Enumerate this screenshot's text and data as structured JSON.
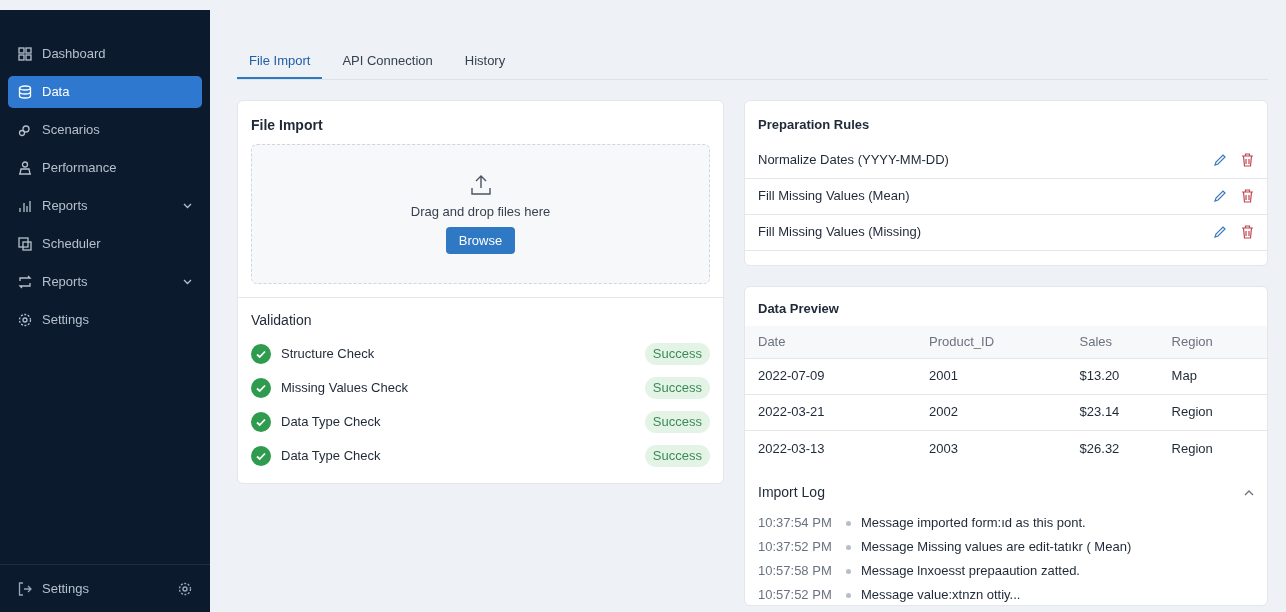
{
  "sidebar": {
    "items": [
      {
        "label": "Dashboard",
        "selected": false
      },
      {
        "label": "Data",
        "selected": true
      },
      {
        "label": "Scenarios",
        "selected": false
      },
      {
        "label": "Performance",
        "selected": false
      },
      {
        "label": "Reports",
        "selected": false,
        "expandable": true
      },
      {
        "label": "Scheduler",
        "selected": false
      },
      {
        "label": "Reports",
        "selected": false,
        "expandable": true
      },
      {
        "label": "Settings",
        "selected": false
      }
    ],
    "footer": {
      "label": "Settings"
    }
  },
  "tabs": [
    {
      "label": "File Import",
      "selected": true
    },
    {
      "label": "API Connection",
      "selected": false
    },
    {
      "label": "History",
      "selected": false
    }
  ],
  "file_import": {
    "title": "File Import",
    "dropzone_text": "Drag and drop files here",
    "button": "Browse"
  },
  "validation": {
    "title": "Validation",
    "items": [
      {
        "label": "Structure Check",
        "status": "Success"
      },
      {
        "label": "Missing Values Check",
        "status": "Success"
      },
      {
        "label": "Data Type Check",
        "status": "Success"
      },
      {
        "label": "Data Type Check",
        "status": "Success"
      }
    ]
  },
  "preparation_rules": {
    "title": "Preparation Rules",
    "rules": [
      "Normalize Dates (YYYY-MM-DD)",
      "Fill Missing Values (Mean)",
      "Fill Missing Values (Missing)"
    ]
  },
  "data_preview": {
    "title": "Data Preview",
    "columns": [
      "Date",
      "Product_ID",
      "Sales",
      "Region"
    ],
    "rows": [
      [
        "2022-07-09",
        "2001",
        "$13.20",
        "Map"
      ],
      [
        "2022-03-21",
        "2002",
        "$23.14",
        "Region"
      ],
      [
        "2022-03-13",
        "2003",
        "$26.32",
        "Region"
      ]
    ]
  },
  "import_log": {
    "title": "Import Log",
    "expanded": true,
    "entries": [
      {
        "time": "10:37:54 PM",
        "message": "Message imported form:ıd as this pont."
      },
      {
        "time": "10:37:52 PM",
        "message": "Message Missing values are edit-tatıkr ( Mean)"
      },
      {
        "time": "10:57:58 PM",
        "message": "Message lnxoesst prepaaution zatted."
      },
      {
        "time": "10:57:52 PM",
        "message": "Message value:xtnzn ottiy..."
      }
    ]
  }
}
